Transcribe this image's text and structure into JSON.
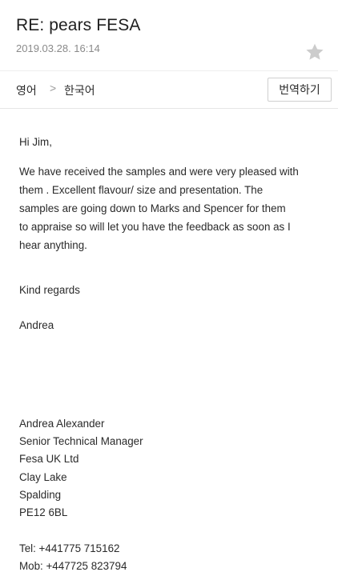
{
  "email": {
    "subject": "RE: pears FESA",
    "date": "2019.03.28. 16:14",
    "star_icon": "star-icon",
    "star_color": "#cccccc"
  },
  "translate": {
    "source_lang": "영어",
    "separator": ">",
    "target_lang": "한국어",
    "button_label": "번역하기"
  },
  "message": {
    "greeting": "Hi Jim,",
    "paragraph_lines": [
      "We have received the samples and were very pleased with",
      "them . Excellent flavour/ size and presentation. The",
      "samples are going down to Marks and Spencer for them",
      "to appraise so will let you have the feedback as soon as I",
      "hear anything."
    ],
    "closing": "Kind regards",
    "sender_short": "Andrea"
  },
  "signature": {
    "name": "Andrea Alexander",
    "title": "Senior Technical Manager",
    "company": "Fesa UK Ltd",
    "address_line1": "Clay Lake",
    "address_line2": "Spalding",
    "postcode": "PE12 6BL",
    "tel": "Tel: +441775 715162",
    "mob": "Mob: +447725 823794"
  }
}
